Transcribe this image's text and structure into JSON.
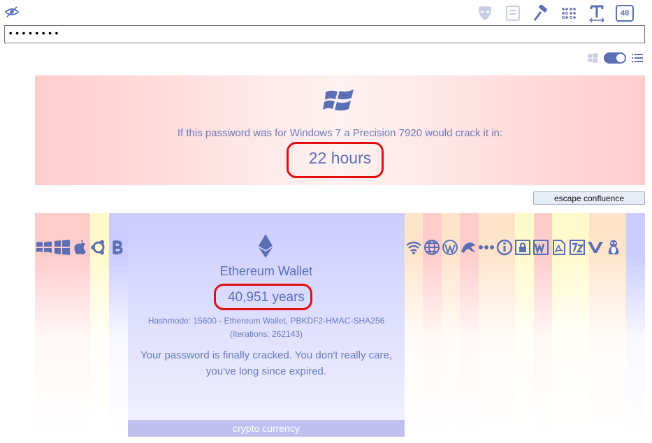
{
  "password": {
    "value": "••••••••"
  },
  "toolbar": {
    "length_badge": "48"
  },
  "windows_panel": {
    "text": "If this password was for Windows 7 a Precision 7920 would crack it in:",
    "time": "22 hours"
  },
  "escape_button": "escape confluence",
  "wallet": {
    "title": "Ethereum Wallet",
    "years": "40,951 years",
    "hashmode_line1": "Hashmode: 15600 - Ethereum Wallet, PBKDF2-HMAC-SHA256",
    "hashmode_line2": "(Iterations: 262143)",
    "message_line1": "Your password is finally cracked. You don't really care,",
    "message_line2": "you've long since expired.",
    "category": "crypto currency"
  },
  "colors": {
    "accent": "#5a6fb4",
    "highlight_circle": "#e01010"
  }
}
